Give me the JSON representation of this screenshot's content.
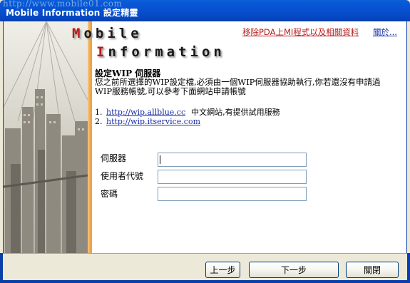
{
  "window": {
    "title": "Mobile Information 設定精靈",
    "watermark": "http://www.mobile01.com"
  },
  "logo": {
    "line1_first": "M",
    "line1_rest": "obile",
    "line2_first": "I",
    "line2_rest": "nformation"
  },
  "links": {
    "remove": "移除PDA上MI程式以及相關資料",
    "about": "關於..."
  },
  "main": {
    "heading": "設定WIP 伺服器",
    "description": "您之前所選擇的WIP設定檔,必須由一個WIP伺服器協助執行,你若還沒有申請過WIP服務帳號,可以參考下面網站申請帳號",
    "servers": [
      {
        "num": "1.",
        "url": "http://wip.allblue.cc",
        "note": "中文網站,有提供試用服務"
      },
      {
        "num": "2.",
        "url": "http://wip.itservice.com",
        "note": ""
      }
    ]
  },
  "form": {
    "server_label": "伺服器",
    "server_value": "",
    "user_label": "使用者代號",
    "user_value": "",
    "password_label": "密碼",
    "password_value": ""
  },
  "buttons": {
    "prev": "上一步",
    "next": "下一步",
    "close": "關閉"
  },
  "colors": {
    "titlebar": "#0750cf",
    "link_red": "#b41c1c",
    "link_blue": "#1a2fa3",
    "banner_accent": "#f0a94d"
  }
}
